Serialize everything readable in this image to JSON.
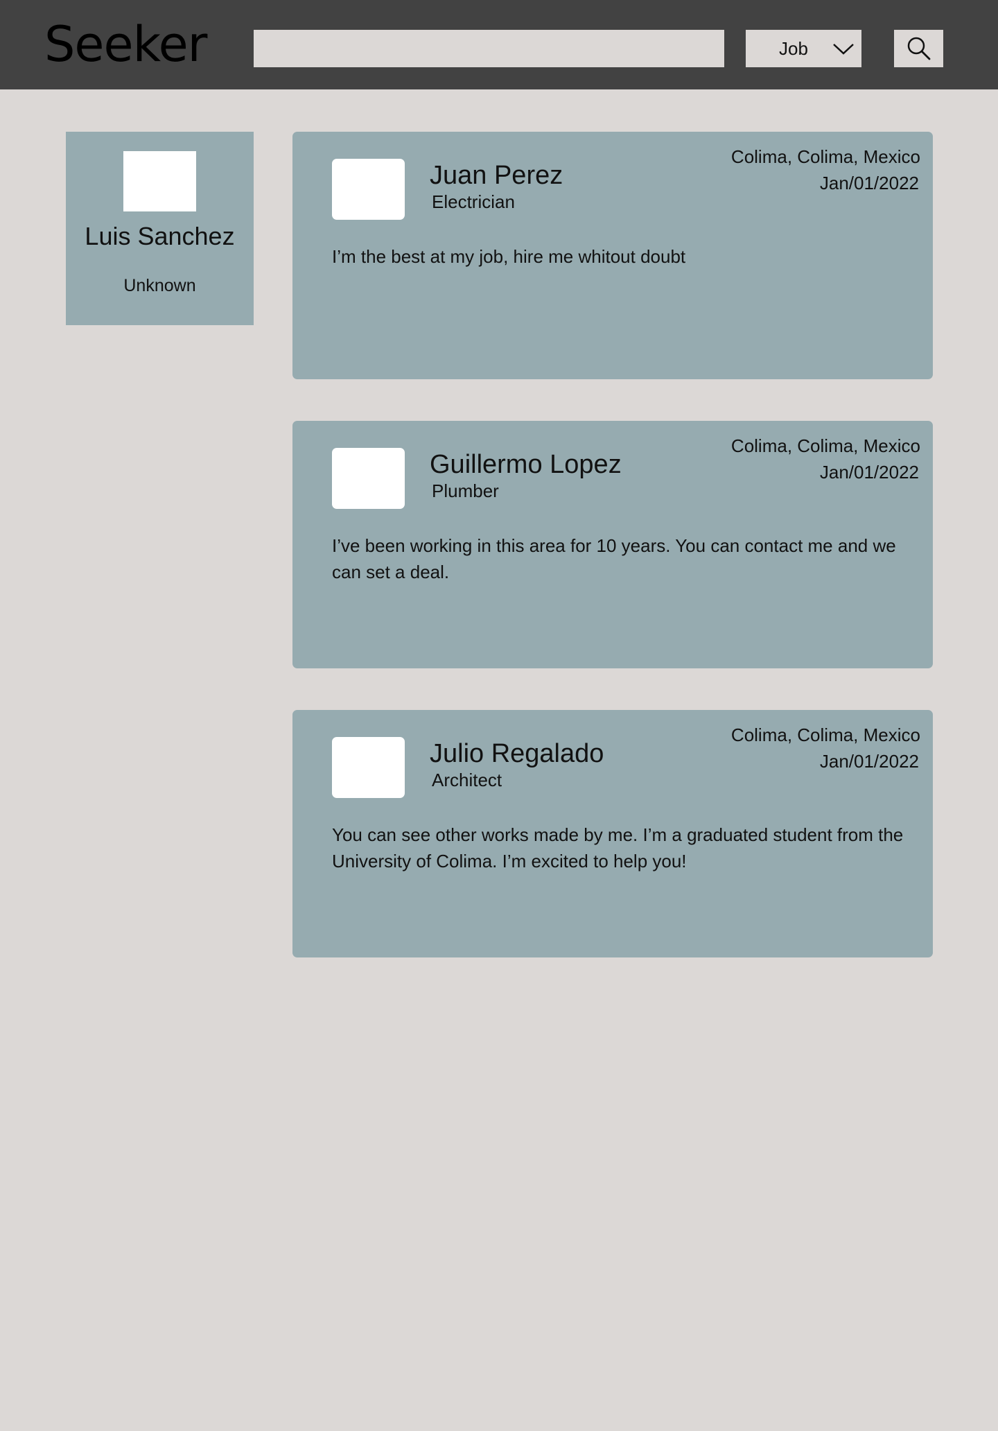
{
  "header": {
    "brand": "Seeker",
    "search_value": "",
    "category_select": "Job",
    "icons": {
      "dropdown": "chevron-down-icon",
      "search": "search-icon"
    }
  },
  "colors": {
    "topbar": "#424242",
    "page_background": "#dcd8d6",
    "card": "#96abb0",
    "avatar": "#ffffff"
  },
  "profile": {
    "name": "Luis Sanchez",
    "role": "Unknown"
  },
  "posts": [
    {
      "name": "Juan Perez",
      "job": "Electrician",
      "location": "Colima, Colima, Mexico",
      "date": "Jan/01/2022",
      "description": "I’m the best at my job, hire me whitout doubt"
    },
    {
      "name": "Guillermo Lopez",
      "job": "Plumber",
      "location": "Colima, Colima, Mexico",
      "date": "Jan/01/2022",
      "description": "I’ve been working in this area for 10 years. You can contact me and we can set a deal."
    },
    {
      "name": "Julio Regalado",
      "job": "Architect",
      "location": "Colima, Colima, Mexico",
      "date": "Jan/01/2022",
      "description": "You can see other works made by me. I’m a graduated student from the University of Colima. I’m excited to help you!"
    }
  ]
}
